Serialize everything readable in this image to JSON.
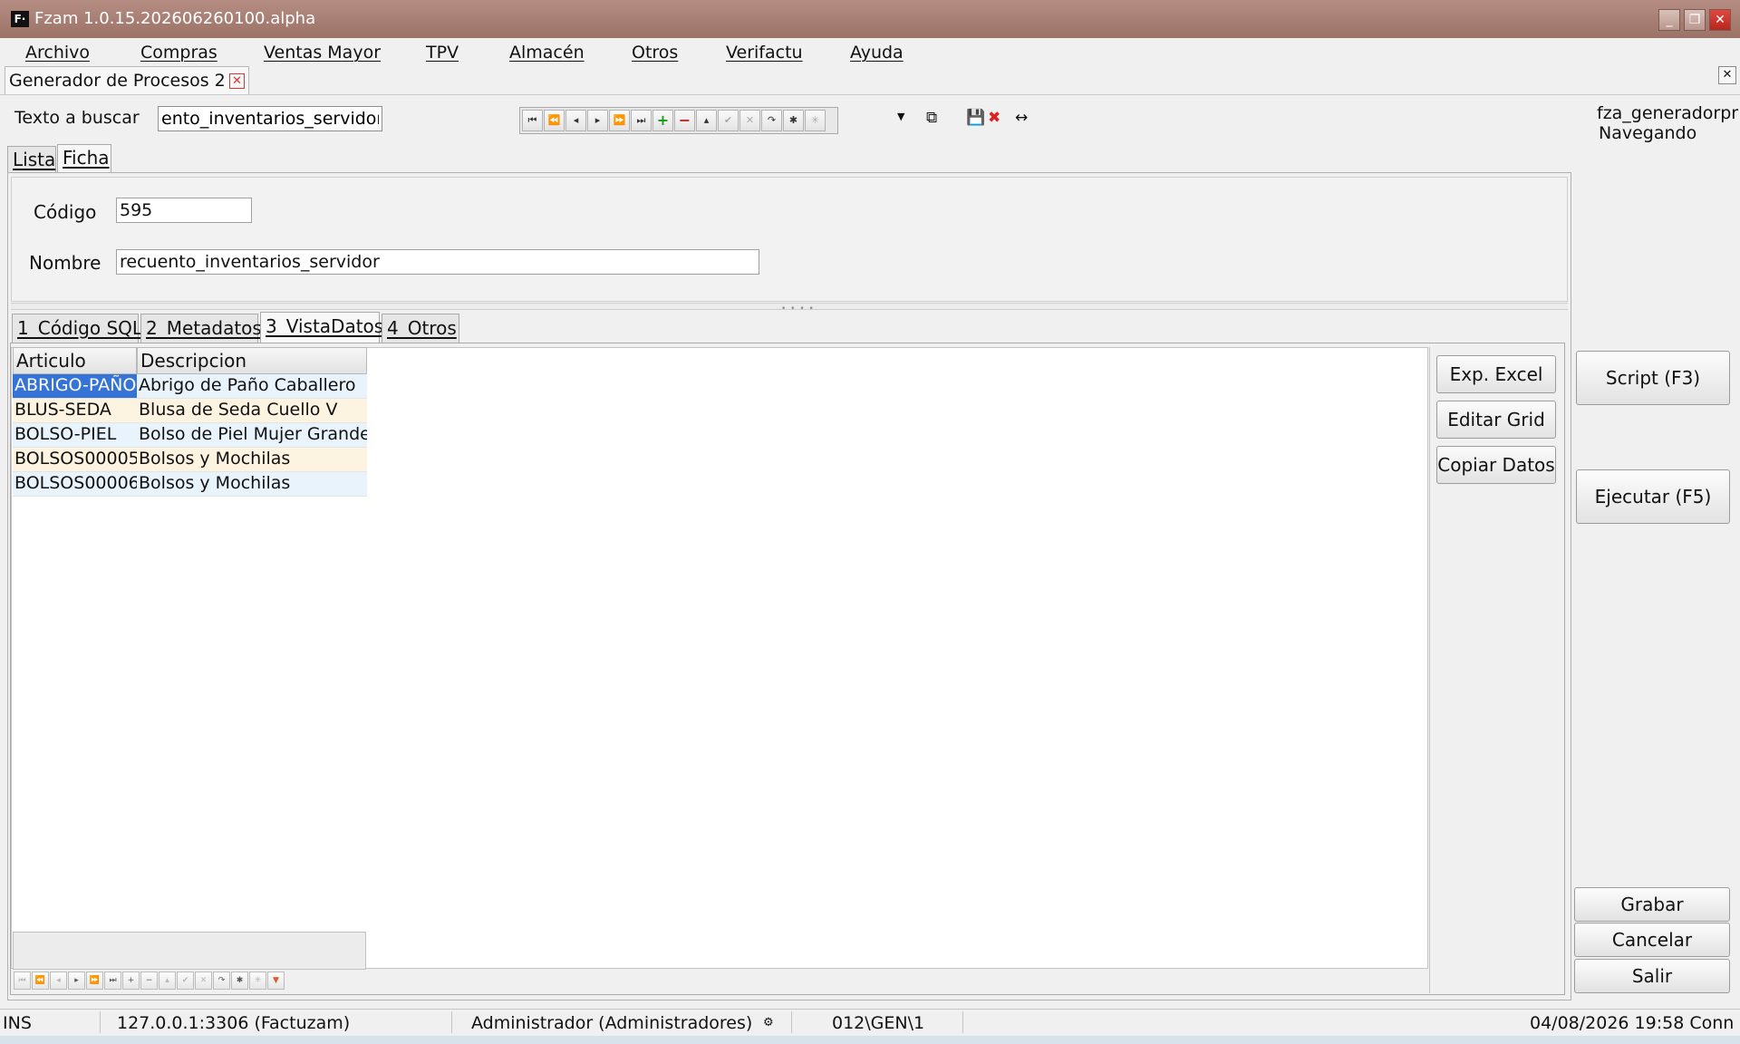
{
  "window": {
    "title": "Fzam 1.0.15.202606260100.alpha",
    "logo_text": "F·"
  },
  "menu": [
    "Archivo",
    "Compras",
    "Ventas Mayor",
    "TPV",
    "Almacén",
    "Otros",
    "Verifactu",
    "Ayuda"
  ],
  "document_tab": {
    "label": "Generador de Procesos 2"
  },
  "search": {
    "label": "Texto a buscar",
    "value": "ento_inventarios_servidor"
  },
  "user_info": {
    "module": "fza_generadorpr",
    "state": "Navegando"
  },
  "main_tabs": {
    "lista": "Lista",
    "ficha": "Ficha"
  },
  "ficha": {
    "codigo_label": "Código",
    "codigo_value": "595",
    "nombre_label": "Nombre",
    "nombre_value": "recuento_inventarios_servidor"
  },
  "sub_tabs": [
    "1_Código SQL",
    "2_Metadatos",
    "3_VistaDatos",
    "4_Otros"
  ],
  "grid": {
    "columns": [
      "Articulo",
      "Descripcion"
    ],
    "rows": [
      [
        "ABRIGO-PAÑO",
        "Abrigo de Paño Caballero"
      ],
      [
        "BLUS-SEDA",
        "Blusa de Seda Cuello V"
      ],
      [
        "BOLSO-PIEL",
        "Bolso de Piel Mujer Grande"
      ],
      [
        "BOLSOS00005",
        "Bolsos y Mochilas"
      ],
      [
        "BOLSOS00006",
        "Bolsos y Mochilas"
      ]
    ],
    "selected_row": 0
  },
  "side_buttons": {
    "exp_excel": "Exp. Excel",
    "editar_grid": "Editar Grid",
    "copiar_datos": "Copiar Datos"
  },
  "right_buttons": {
    "script": "Script (F3)",
    "ejecutar": "Ejecutar (F5)",
    "grabar": "Grabar",
    "cancelar": "Cancelar",
    "salir": "Salir"
  },
  "status": {
    "mode": "INS",
    "connection": "127.0.0.1:3306 (Factuzam)",
    "user": "Administrador (Administradores)",
    "path": "012\\GEN\\1",
    "datetime": "04/08/2026 19:58 Conn"
  },
  "colors": {
    "titlebar": "#a57a6f",
    "selection": "#3574d6",
    "row_alt_a": "#e8f3fb",
    "row_alt_b": "#fdf3e1"
  }
}
